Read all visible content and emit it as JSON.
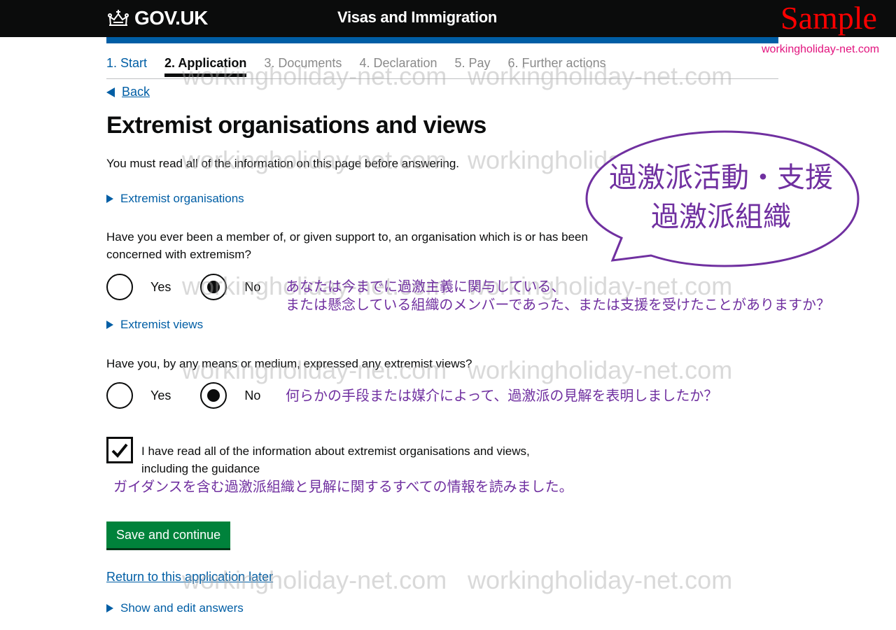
{
  "header": {
    "logo_text": "GOV.UK",
    "service_name": "Visas and Immigration",
    "sample_label": "Sample",
    "site_tag": "workingholiday-net.com"
  },
  "steps": [
    {
      "label": "1. Start",
      "state": "done"
    },
    {
      "label": "2. Application",
      "state": "current"
    },
    {
      "label": "3. Documents",
      "state": "upcoming"
    },
    {
      "label": "4. Declaration",
      "state": "upcoming"
    },
    {
      "label": "5. Pay",
      "state": "upcoming"
    },
    {
      "label": "6. Further actions",
      "state": "upcoming"
    }
  ],
  "back_label": "Back",
  "page_title": "Extremist organisations and views",
  "intro": "You must read all of the information on this page before answering.",
  "details": {
    "organisations": "Extremist organisations",
    "views": "Extremist views",
    "show_edit": "Show and edit answers"
  },
  "q1": {
    "text": "Have you ever been a member of, or given support to, an organisation which is or has been concerned with extremism?",
    "options": [
      "Yes",
      "No"
    ],
    "selected": "No"
  },
  "q2": {
    "text": "Have you, by any means or medium, expressed any extremist views?",
    "options": [
      "Yes",
      "No"
    ],
    "selected": "No"
  },
  "confirm": {
    "checked": true,
    "label": "I have read all of the information about extremist organisations and views, including the guidance"
  },
  "save_button": "Save and continue",
  "return_link": "Return to this application later",
  "annotations": {
    "bubble_line1": "過激派活動・支援",
    "bubble_line2": "過激派組織",
    "q1_line1": "あなたは今までに過激主義に関与している、",
    "q1_line2": "または懸念している組織のメンバーであった、または支援を受けたことがありますか？",
    "q2": "何らかの手段または媒介によって、過激派の見解を表明しましたか？",
    "confirm": "ガイダンスを含む過激派組織と見解に関するすべての情報を読みました。"
  },
  "watermark": "workingholiday-net.com",
  "colors": {
    "header_bg": "#0b0c0c",
    "link_blue": "#005ea5",
    "button_green": "#00823b",
    "annotation_purple": "#7030a0",
    "sample_red": "#ff0000",
    "tag_pink": "#e2137e"
  }
}
